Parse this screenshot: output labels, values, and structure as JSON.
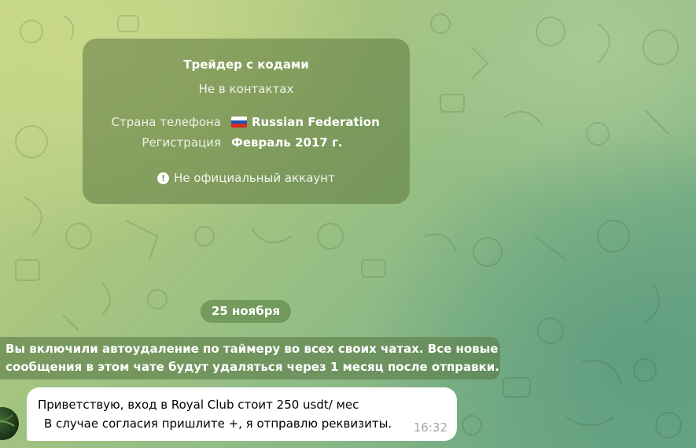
{
  "contact_card": {
    "name": "Трейдер с кодами",
    "status": "Не в контактах",
    "phone_country_label": "Страна телефона",
    "phone_country_value": "Russian Federation",
    "phone_country_flag": "flag-russia-icon",
    "registration_label": "Регистрация",
    "registration_value": "Февраль 2017 г.",
    "warning_text": "Не официальный аккаунт",
    "warning_icon": "exclamation-circle-icon"
  },
  "date_separator": "25 ноября",
  "service_message": {
    "line1": "Вы включили автоудаление по таймеру во всех своих чатах. Все новые",
    "line2": "сообщения в этом чате будут удаляться через 1 месяц после отправки."
  },
  "messages": [
    {
      "line1": "Приветствую, вход в Royal Club стоит 250 usdt/ мес",
      "line2": "В случае согласия пришлите +, я отправлю реквизиты.",
      "time": "16:32"
    }
  ],
  "colors": {
    "card_bg": "#5c7840",
    "bubble_bg": "#ffffff",
    "time_color": "#a0a8ae",
    "flag_white": "#ffffff",
    "flag_blue": "#1f4fb5",
    "flag_red": "#d52b1e"
  }
}
